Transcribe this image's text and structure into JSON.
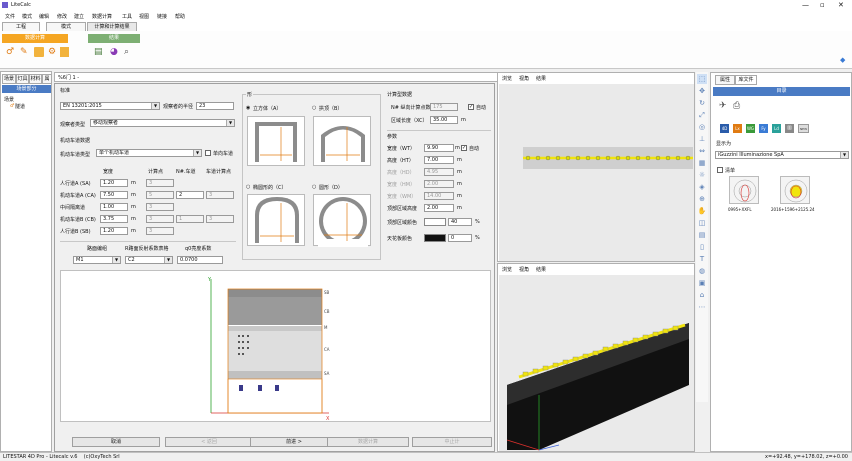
{
  "window": {
    "title": "LiteCalc"
  },
  "menu": [
    "文件",
    "模式",
    "编辑",
    "修改",
    "建立",
    "数据计算",
    "工具",
    "视图",
    "链接",
    "帮助"
  ],
  "ribbon": {
    "tabs": [
      "工程",
      "模式",
      "计算和计算结果"
    ],
    "group1": "数据计算",
    "group2": "结果"
  },
  "left_tabs": [
    "场景",
    "灯具",
    "材料",
    "属"
  ],
  "tree": {
    "header": "场景部分",
    "root": "场景",
    "child": "隧道"
  },
  "toolbar_name": "%6门 1 -",
  "views": {
    "top_menu": [
      "浏览",
      "视角",
      "结果"
    ],
    "bottom_menu": [
      "浏览",
      "视角",
      "结果"
    ]
  },
  "right_panel": {
    "tabs": [
      "属性",
      "库文件"
    ],
    "header": "目录",
    "display_label": "显示为",
    "manufacturer": "iGuzzini Illuminazione SpA",
    "list_label": "清单",
    "item1": "0995+XXFL",
    "item2": "2016+1596+2125.24",
    "badges": [
      "4D",
      "Lx",
      "WG",
      "Fy",
      "Ld",
      "",
      "NEW"
    ]
  },
  "dialog": {
    "standard_section": "标准",
    "standard_value": "EN 13201:2015",
    "angle_label": "观察者的半径",
    "angle_value": "23",
    "observer_label": "观察者类型",
    "observer_value": "移动观察者",
    "motor_section": "机动车道数据",
    "motor_type_label": "机动车道类型",
    "motor_type_value": "单个机动车道",
    "oneway_label": "单向车道",
    "cols": [
      "宽度",
      "计算点",
      "N#.车道",
      "车道计算点"
    ],
    "rows": [
      {
        "label": "人行道A (SA)",
        "w": "1.20",
        "u": "m",
        "p": "3",
        "n": "",
        "q": ""
      },
      {
        "label": "机动车道A (CA)",
        "w": "7.50",
        "u": "m",
        "p": "5",
        "n": "2",
        "q": "3"
      },
      {
        "label": "中间隔离道",
        "w": "1.00",
        "u": "m",
        "p": "3",
        "n": "",
        "q": ""
      },
      {
        "label": "机动车道B (CB)",
        "w": "3.75",
        "u": "m",
        "p": "3",
        "n": "1",
        "q": "3"
      },
      {
        "label": "人行道B (SB)",
        "w": "1.20",
        "u": "m",
        "p": "3",
        "n": "",
        "q": ""
      }
    ],
    "material_labels": [
      "路面编组",
      "R路面反射系数表格",
      "q0亮度系数"
    ],
    "material_values": [
      "M1",
      "C2",
      "0.0700"
    ],
    "shape_section": "形",
    "shapes": [
      "立方体（A）",
      "拱顶（B）",
      "椭圆形的（C）",
      "圆形（D）"
    ],
    "calc_section": "计算型数据",
    "calc_nodes_label": "N# 纵向计算点数",
    "calc_nodes_value": "175",
    "auto_label": "自动",
    "area_len_label": "区域长度（XC）",
    "area_len_value": "35.00",
    "area_len_unit": "m",
    "params_section": "参数",
    "params": [
      {
        "label": "宽度（WT）",
        "value": "9.90",
        "unit": "m",
        "dis": false
      },
      {
        "label": "高度（HT）",
        "value": "7.00",
        "unit": "m",
        "dis": false
      },
      {
        "label": "高度（HD）",
        "value": "4.95",
        "unit": "m",
        "dis": true
      },
      {
        "label": "宽度（HM）",
        "value": "2.00",
        "unit": "m",
        "dis": true
      },
      {
        "label": "宽度（WM）",
        "value": "14.00",
        "unit": "m",
        "dis": true
      },
      {
        "label": "顶部区域高度",
        "value": "2.00",
        "unit": "m",
        "dis": false
      }
    ],
    "auto2_label": "自动",
    "wall_color_label": "顶部区域颜色",
    "wall_color_value": "40",
    "wall_color_unit": "%",
    "ceiling_color_label": "天花板颜色",
    "ceiling_color_value": "0",
    "ceiling_color_unit": "%",
    "buttons": [
      "取消",
      "< 返回",
      "前进 >",
      "数据计算",
      "中止计"
    ],
    "section_labels": [
      "SB",
      "CB",
      "M",
      "CA",
      "SA"
    ]
  },
  "status": {
    "left": "LITESTAR 4D Pro - Litecalc v.6    (c)OxyTech Srl",
    "right": "x=+92.48, y=+178.02, z=+0.00"
  }
}
